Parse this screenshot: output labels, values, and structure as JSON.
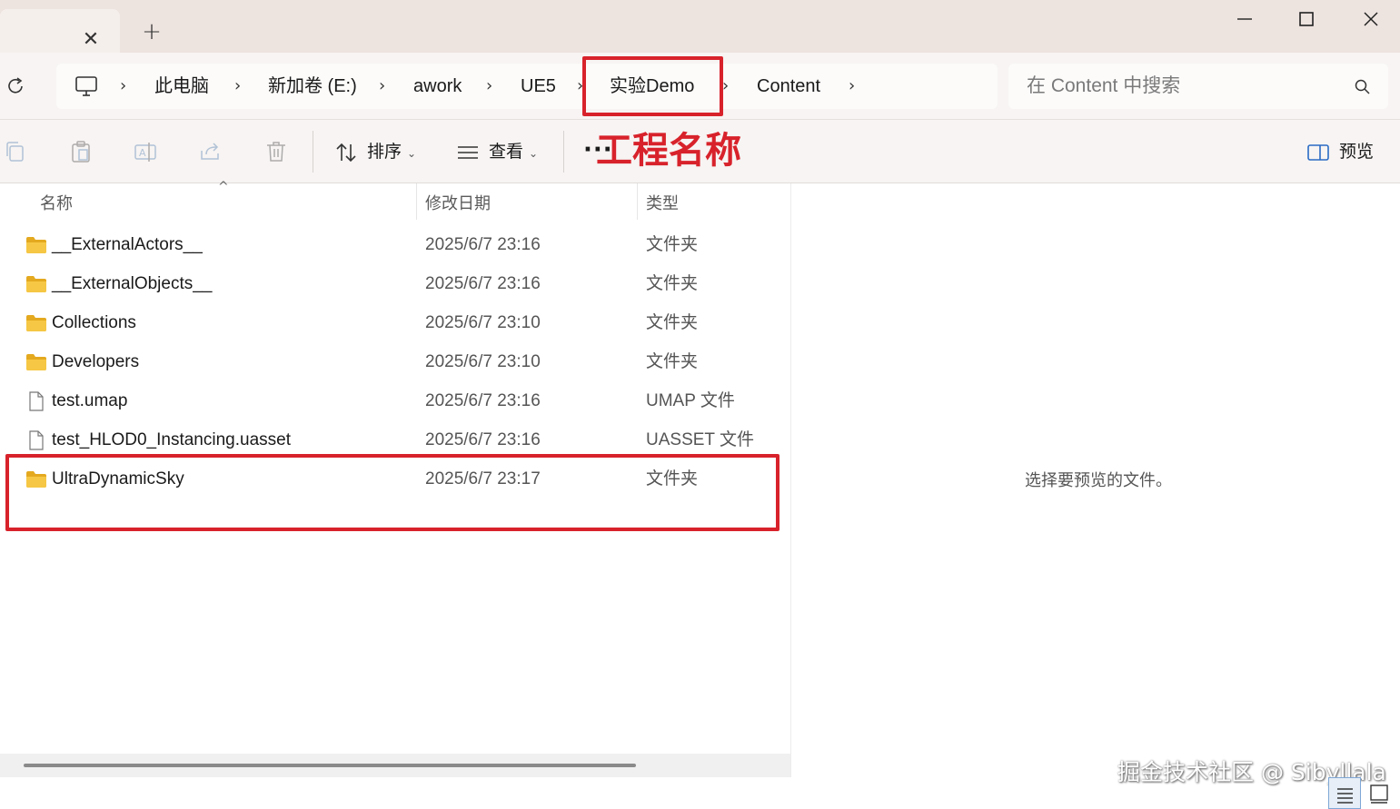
{
  "tabs": {
    "close_glyph": "✕",
    "new_tab_glyph": "+"
  },
  "address": {
    "breadcrumbs": [
      "此电脑",
      "新加卷 (E:)",
      "awork",
      "UE5",
      "实验Demo",
      "Content"
    ],
    "chevron": "›",
    "search_placeholder": "在 Content 中搜索"
  },
  "toolbar": {
    "sort_label": "排序",
    "view_label": "查看",
    "more_label": "···",
    "preview_label": "预览",
    "dropdown_glyph": "⌄",
    "icons": [
      "copy-icon",
      "paste-icon",
      "rename-icon",
      "share-icon",
      "delete-icon"
    ]
  },
  "annotation": {
    "label": "工程名称",
    "color": "#d8222b"
  },
  "columns": {
    "name": "名称",
    "date": "修改日期",
    "type": "类型",
    "sort_glyph": "^"
  },
  "files": [
    {
      "name": "__ExternalActors__",
      "date": "2025/6/7 23:16",
      "type": "文件夹",
      "kind": "folder"
    },
    {
      "name": "__ExternalObjects__",
      "date": "2025/6/7 23:16",
      "type": "文件夹",
      "kind": "folder"
    },
    {
      "name": "Collections",
      "date": "2025/6/7 23:10",
      "type": "文件夹",
      "kind": "folder"
    },
    {
      "name": "Developers",
      "date": "2025/6/7 23:10",
      "type": "文件夹",
      "kind": "folder"
    },
    {
      "name": "test.umap",
      "date": "2025/6/7 23:16",
      "type": "UMAP 文件",
      "kind": "file"
    },
    {
      "name": "test_HLOD0_Instancing.uasset",
      "date": "2025/6/7 23:16",
      "type": "UASSET 文件",
      "kind": "file"
    },
    {
      "name": "UltraDynamicSky",
      "date": "2025/6/7 23:17",
      "type": "文件夹",
      "kind": "folder"
    }
  ],
  "preview": {
    "empty_message": "选择要预览的文件。"
  },
  "watermark": "掘金技术社区 @ Sibyllala",
  "colors": {
    "folder": "#f6c744",
    "folder_dark": "#e4a91f",
    "highlight": "#d8222b"
  }
}
